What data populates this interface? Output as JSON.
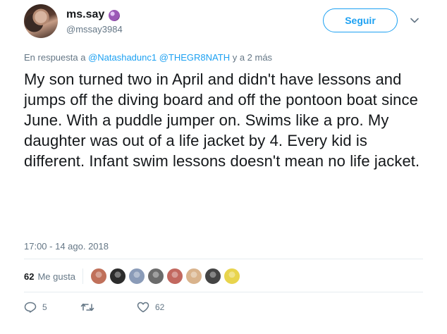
{
  "user": {
    "display_name": "ms.say",
    "handle": "@mssay3984",
    "emoji_icon": "crystal-ball-emoji"
  },
  "follow_button": {
    "label": "Seguir"
  },
  "reply": {
    "prefix": "En respuesta a ",
    "mention1": "@Natashadunc1",
    "mention2": "@THEGR8NATH",
    "suffix": " y a 2 más"
  },
  "tweet": {
    "text": "My son turned two in April and didn't have lessons and jumps off the diving board and off the pontoon boat since June. With a puddle jumper on. Swims like a pro. My daughter was out of a life jacket by 4. Every kid is different. Infant swim lessons doesn't mean no life jacket."
  },
  "timestamp": "17:00 - 14 ago. 2018",
  "likes": {
    "count": "62",
    "label": "Me gusta",
    "avatar_colors": [
      "#c0705a",
      "#2c2c2c",
      "#8a9bb8",
      "#6b6b6b",
      "#c2685f",
      "#d9b38c",
      "#444444",
      "#e8d44d"
    ]
  },
  "actions": {
    "reply_count": "5",
    "retweet_count": "",
    "like_count": "62"
  },
  "colors": {
    "accent": "#1da1f2",
    "secondary_text": "#657786",
    "primary_text": "#14171a"
  }
}
